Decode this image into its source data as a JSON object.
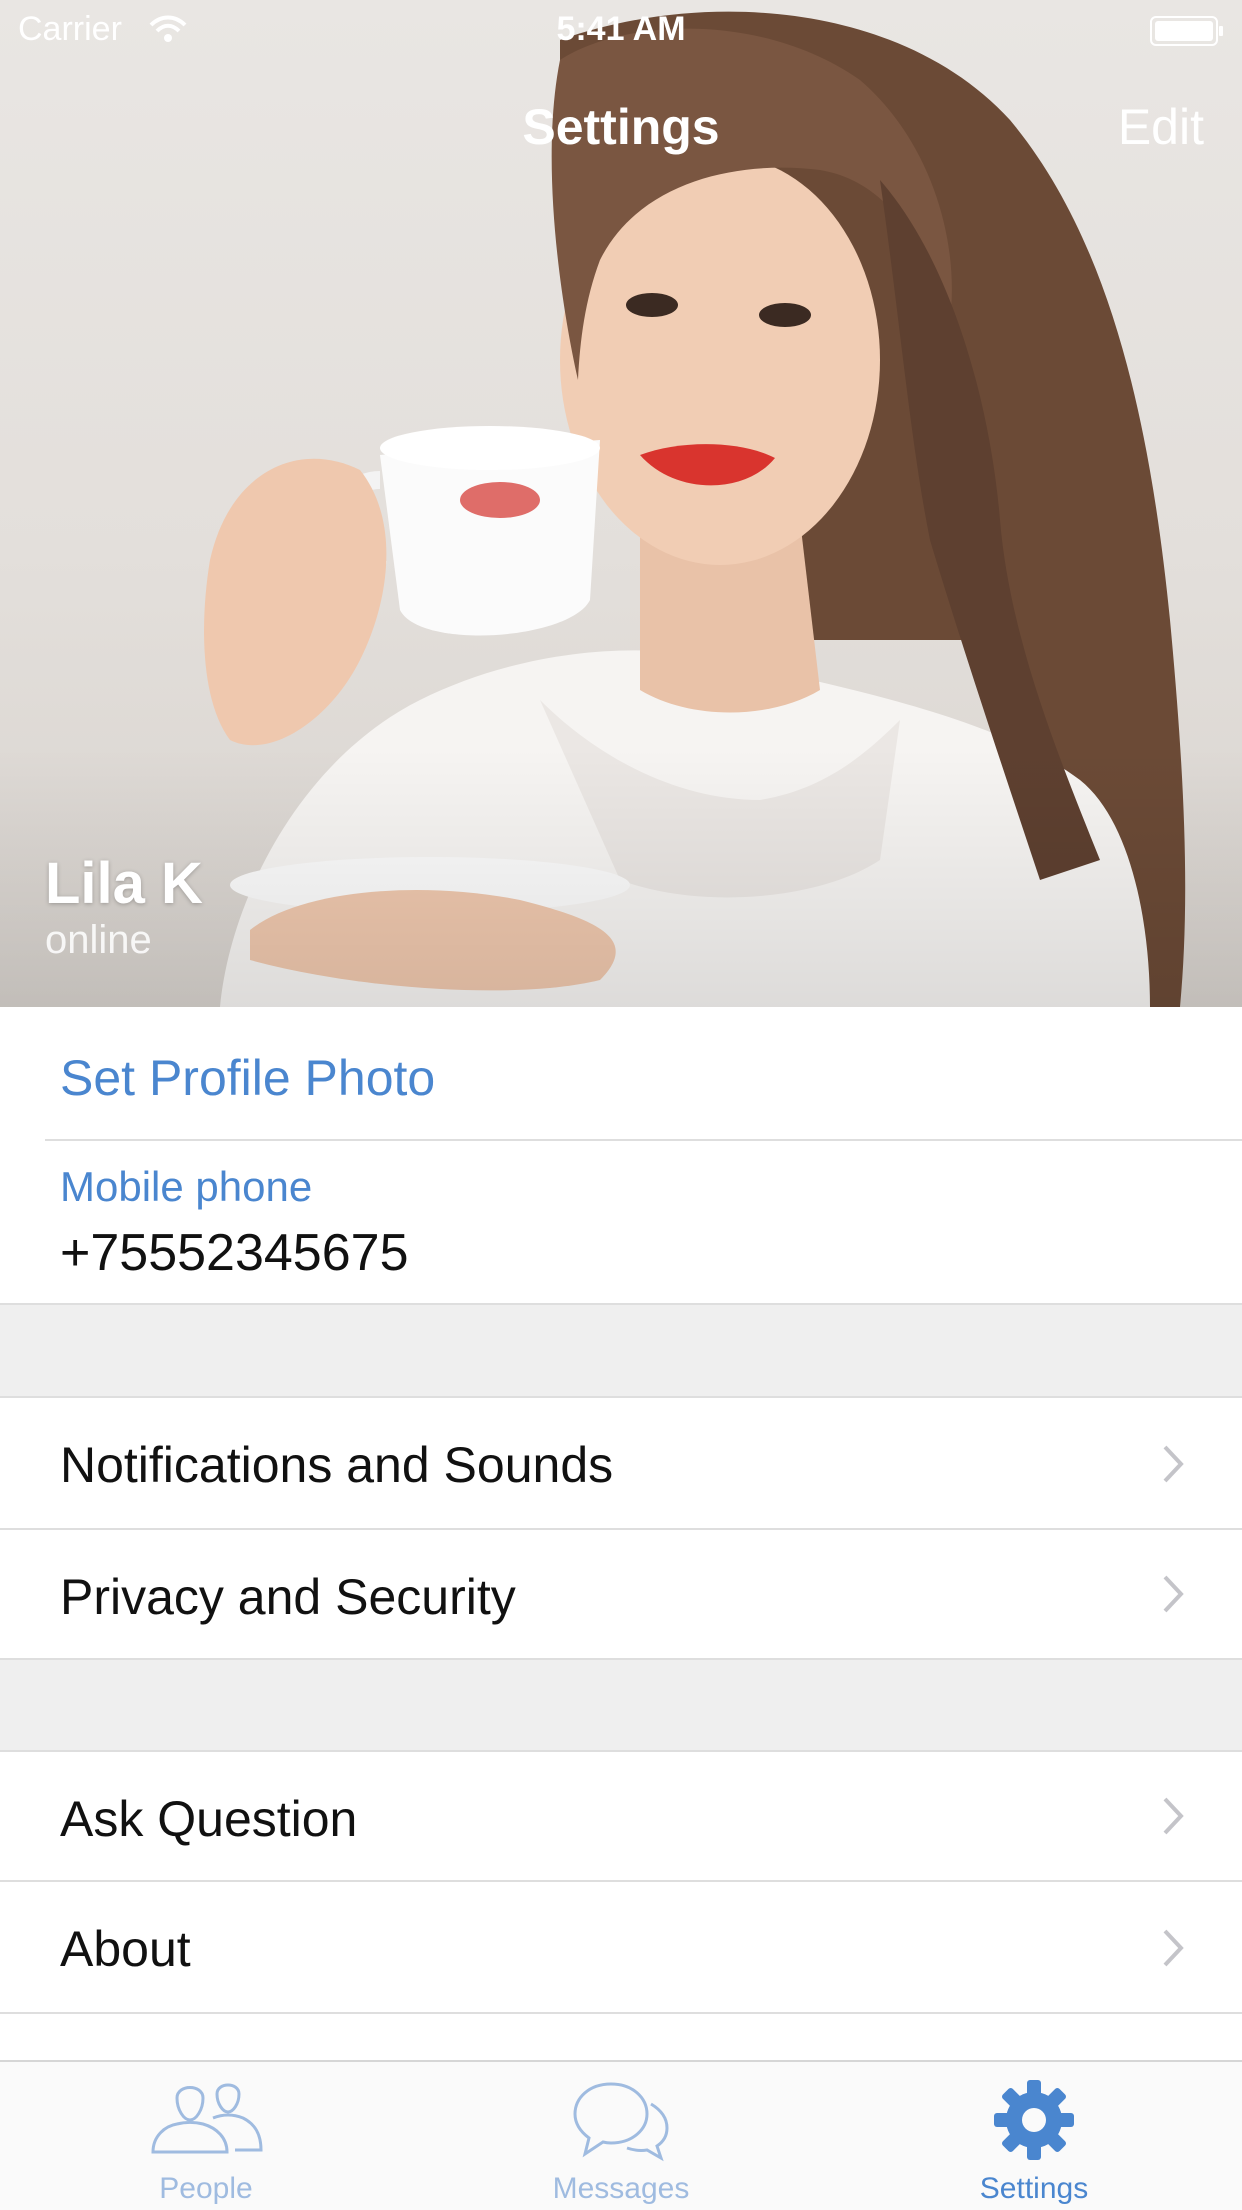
{
  "status_bar": {
    "carrier": "Carrier",
    "time": "5:41 AM"
  },
  "nav": {
    "title": "Settings",
    "edit_label": "Edit"
  },
  "profile": {
    "name": "Lila K",
    "status": "online",
    "photo_icon": "person-photo"
  },
  "account": {
    "set_photo_label": "Set Profile Photo",
    "phone_caption": "Mobile phone",
    "phone_value": "+75552345675"
  },
  "settings_group": {
    "items": [
      {
        "label": "Notifications and Sounds"
      },
      {
        "label": "Privacy and Security"
      }
    ]
  },
  "support_group": {
    "items": [
      {
        "label": "Ask Question"
      },
      {
        "label": "About"
      }
    ]
  },
  "tab_bar": {
    "tabs": [
      {
        "label": "People",
        "icon": "people-icon",
        "active": false
      },
      {
        "label": "Messages",
        "icon": "messages-icon",
        "active": false
      },
      {
        "label": "Settings",
        "icon": "gear-icon",
        "active": true
      }
    ]
  },
  "colors": {
    "accent": "#4a86cf",
    "inactive_tab": "#9fbbe0",
    "section_gap": "#efefef",
    "separator": "#dedede"
  }
}
